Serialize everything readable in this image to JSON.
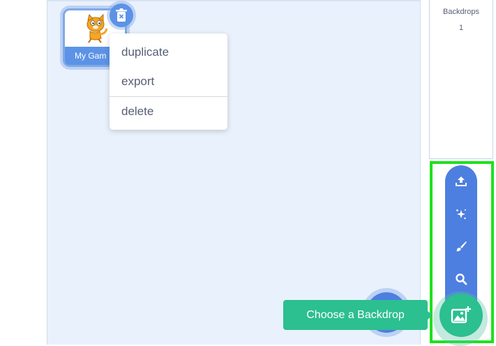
{
  "sprite": {
    "name": "My Gam",
    "thumbnail_icon": "scratch-cat-icon",
    "delete_icon": "trash-icon"
  },
  "context_menu": {
    "items": [
      "duplicate",
      "export",
      "delete"
    ]
  },
  "stage": {
    "backdrops_label": "Backdrops",
    "backdrops_count": "1"
  },
  "backdrop_menu": {
    "icons": [
      "upload-icon",
      "surprise-icon",
      "paint-icon",
      "search-icon"
    ],
    "main_icon": "add-backdrop-icon",
    "tooltip": "Choose a Backdrop"
  },
  "colors": {
    "scratch_blue": "#4d7fe0",
    "sprite_selected": "#5c93e6",
    "backdrop_green": "#2cbf8f",
    "highlight": "#1ce21c",
    "pane_bg": "#e9f1fc"
  }
}
